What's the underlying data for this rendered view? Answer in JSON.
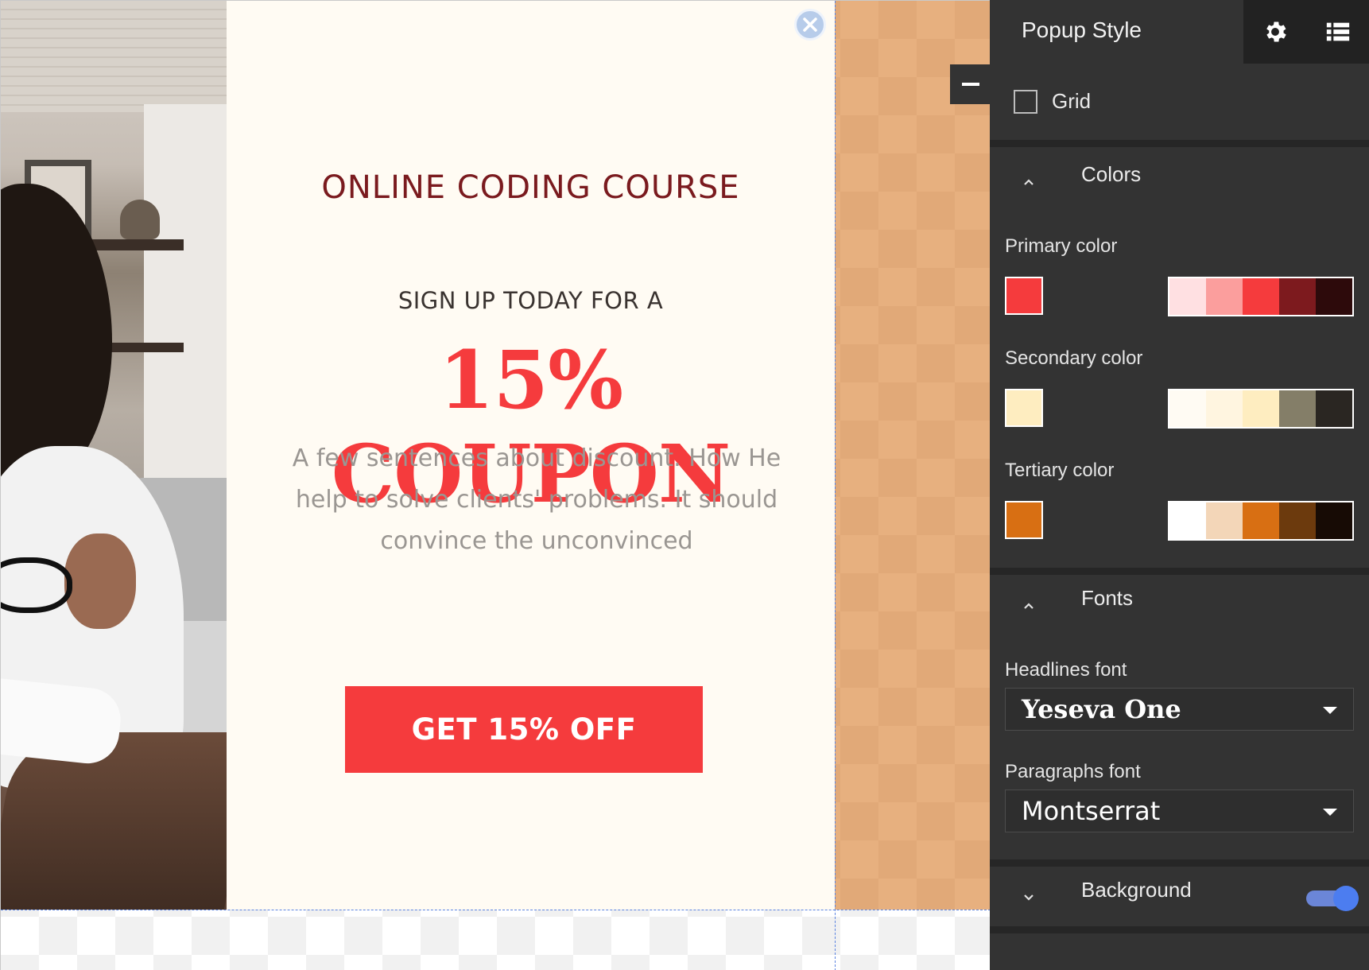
{
  "popup": {
    "headline": "ONLINE CODING COURSE",
    "subheadline": "SIGN UP TODAY FOR A",
    "coupon": "15% COUPON",
    "description": "A few sentences about discount. How He help to solve clients' problems. It should convince the unconvinced",
    "cta_label": "GET 15% OFF"
  },
  "sidebar": {
    "title": "Popup Style",
    "tabs": [
      {
        "icon": "gear-icon"
      },
      {
        "icon": "list-icon"
      }
    ],
    "grid_label": "Grid",
    "grid_checked": false,
    "colors": {
      "section_label": "Colors",
      "primary": {
        "label": "Primary color",
        "selected": "#f53b3d",
        "palette": [
          "#ffe0e2",
          "#fb9e9d",
          "#f53b3d",
          "#7d1a1e",
          "#2d0a0b"
        ]
      },
      "secondary": {
        "label": "Secondary color",
        "selected": "#feedc0",
        "palette": [
          "#fffbf3",
          "#fff5e0",
          "#feedc0",
          "#847e68",
          "#2a2622"
        ]
      },
      "tertiary": {
        "label": "Tertiary color",
        "selected": "#d86f13",
        "palette": [
          "#ffffff",
          "#f3d6b8",
          "#d86f13",
          "#6c3a0d",
          "#170b05"
        ]
      }
    },
    "fonts": {
      "section_label": "Fonts",
      "headlines_label": "Headlines font",
      "headlines_value": "Yeseva One",
      "paragraphs_label": "Paragraphs font",
      "paragraphs_value": "Montserrat"
    },
    "background": {
      "section_label": "Background",
      "enabled": true
    }
  },
  "colors": {
    "accent": "#f53b3d",
    "panel_bg": "#fffbf3",
    "sidebar_bg": "#333333",
    "canvas_bg": "#e7b07f",
    "toggle": "#4c7df0"
  }
}
